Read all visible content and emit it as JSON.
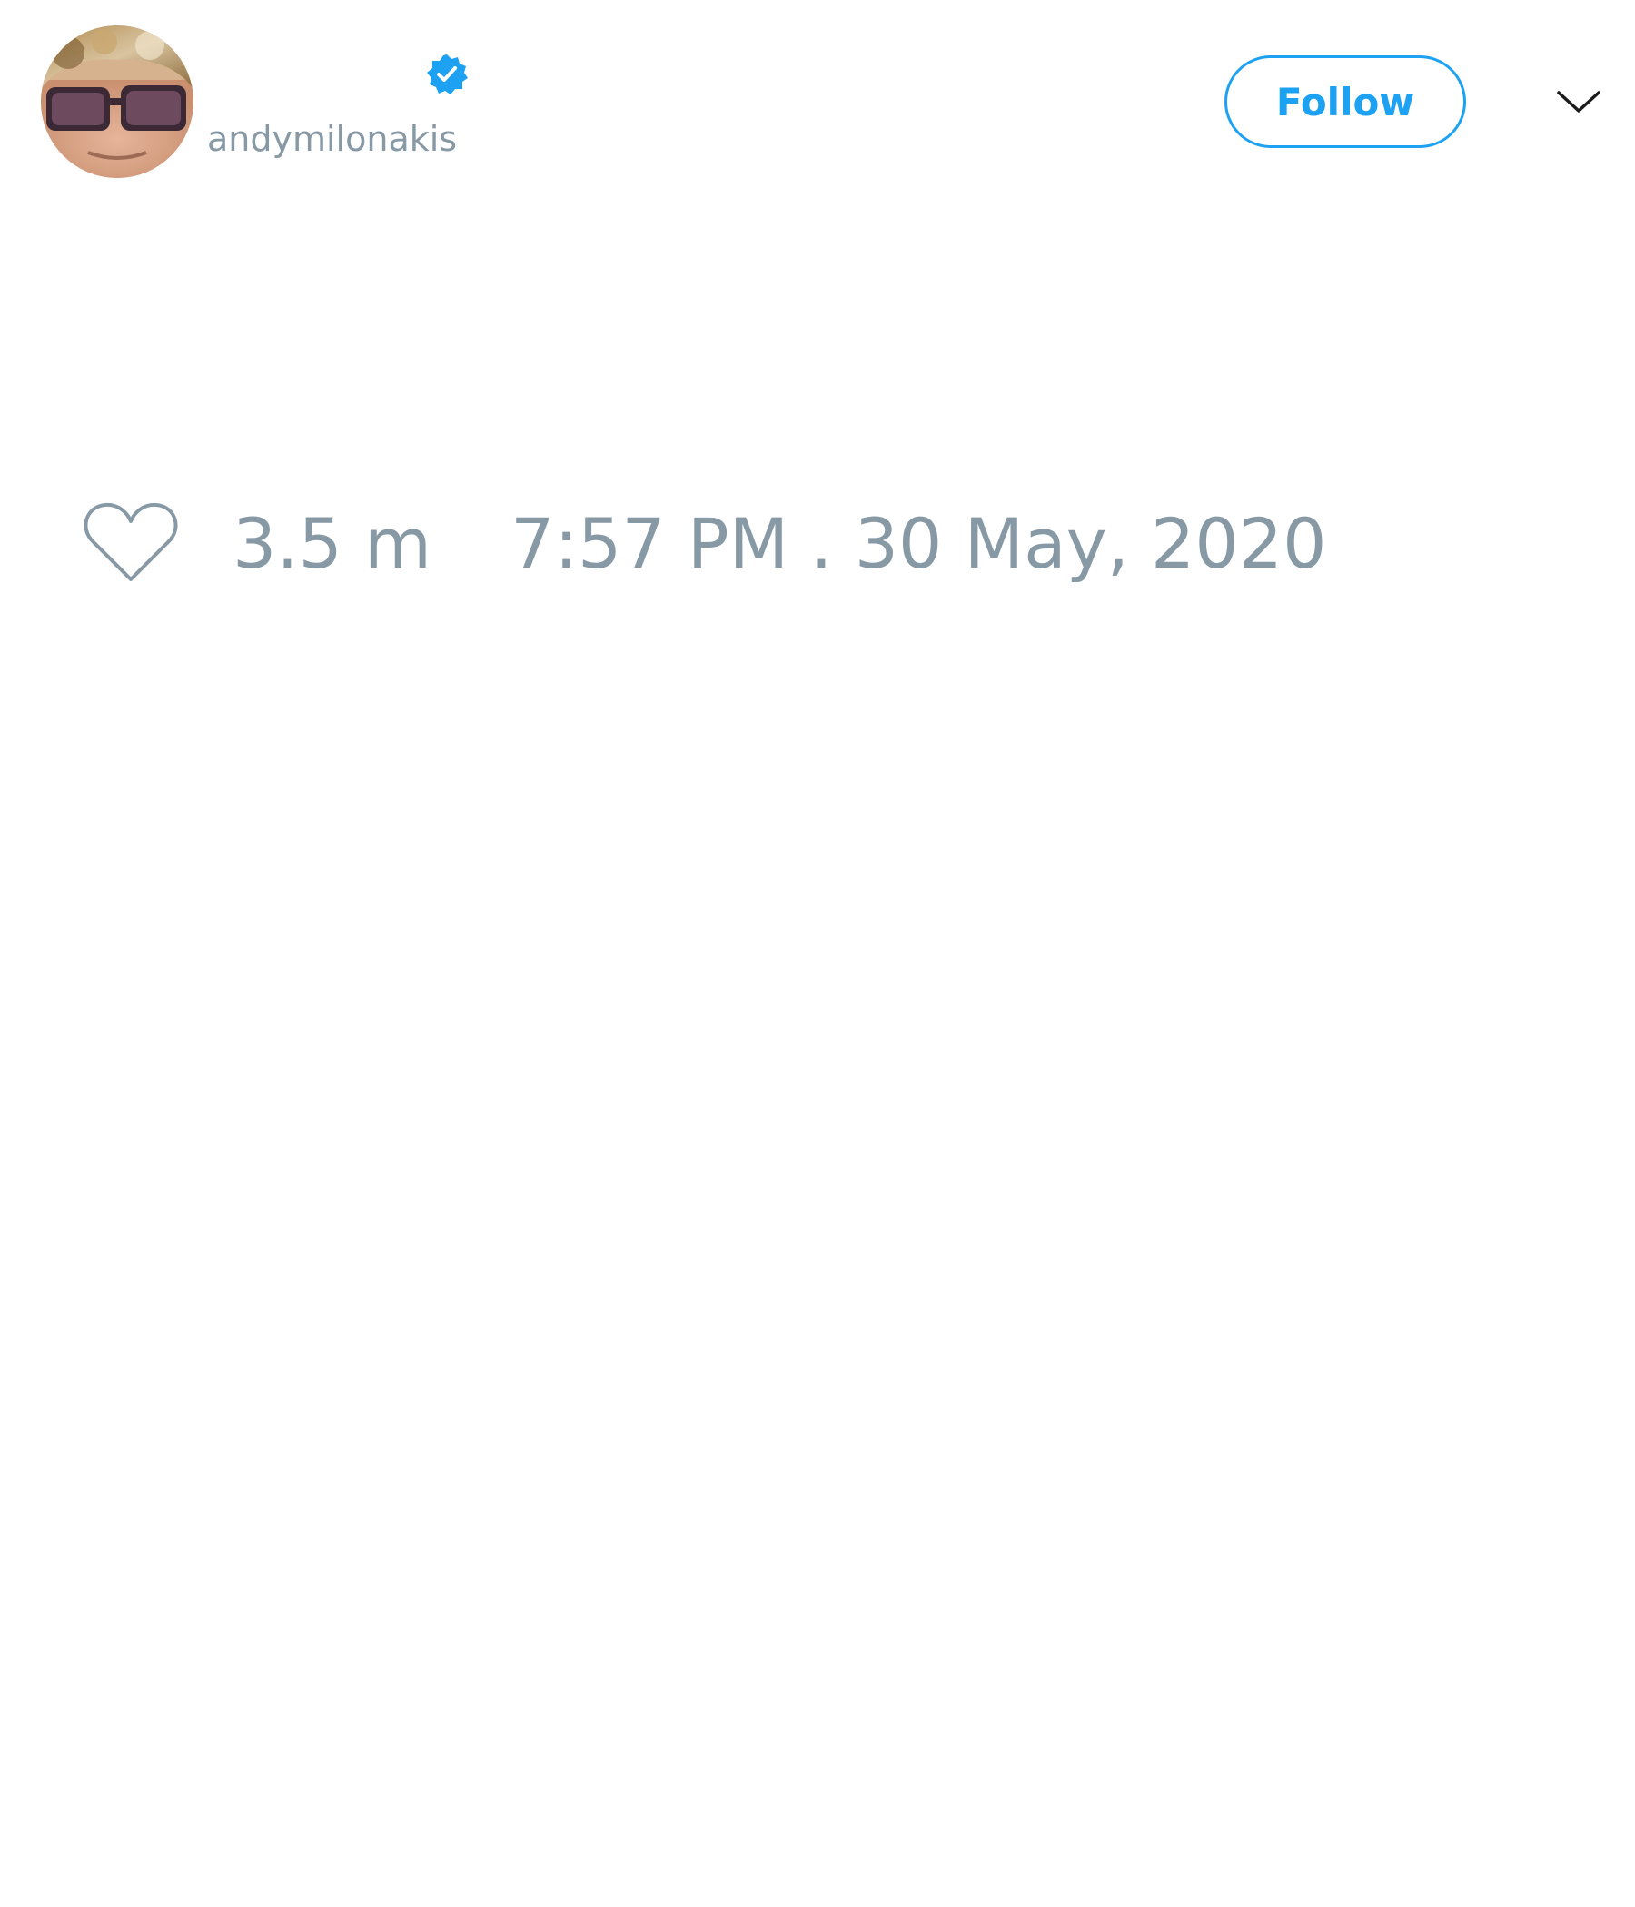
{
  "tweet": {
    "author": {
      "handle": "andymilonakis",
      "verified": true,
      "avatar_icon": "user-avatar-photo"
    },
    "follow_label": "Follow",
    "menu_icon": "chevron-down-icon",
    "like_icon": "heart-outline-icon",
    "like_count": "3.5 m",
    "timestamp": "7:57 PM . 30 May, 2020"
  },
  "colors": {
    "accent": "#1da1f2",
    "muted_text": "#8899a6",
    "background": "#ffffff"
  }
}
